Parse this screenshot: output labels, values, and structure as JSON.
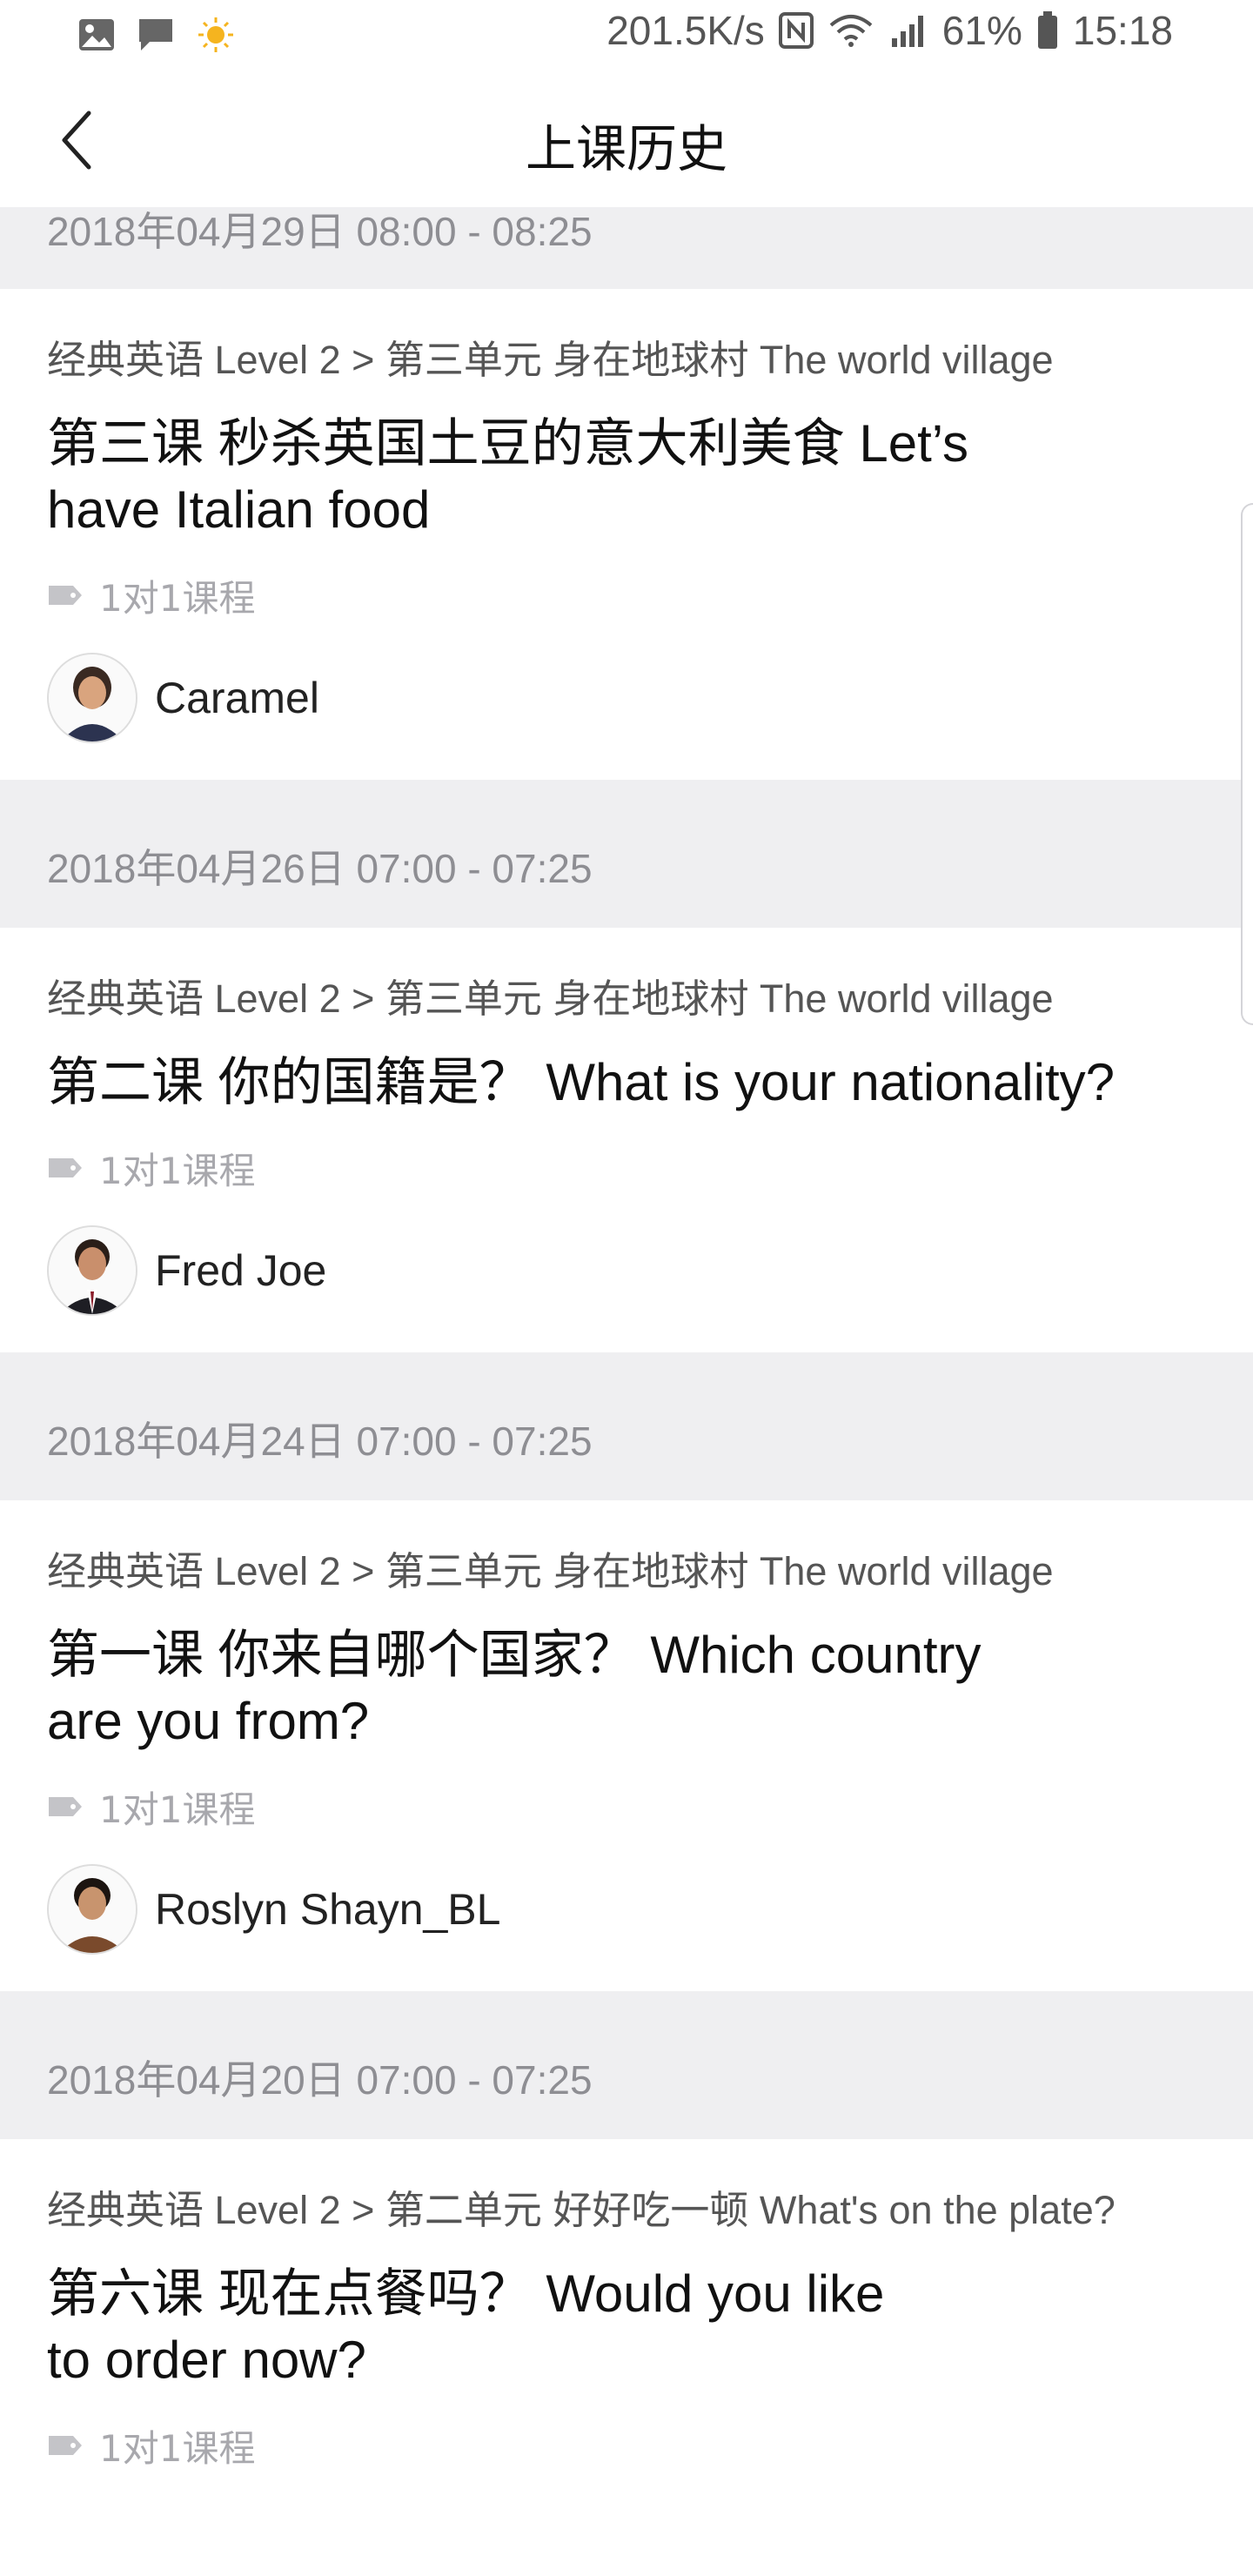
{
  "status_bar": {
    "network_speed": "201.5K/s",
    "battery_percent": "61%",
    "time": "15:18",
    "icons": [
      "gallery-icon",
      "message-icon",
      "weather-sun-icon",
      "nfc-icon",
      "wifi-icon",
      "signal-icon",
      "battery-icon"
    ]
  },
  "nav": {
    "title": "上课历史",
    "back_icon": "chevron-left-icon"
  },
  "sessions": [
    {
      "date": "2018年04月29日 08:00 - 08:25",
      "breadcrumb": "经典英语 Level 2 > 第三单元 身在地球村 The world village",
      "title_line1": "第三课 秒杀英国土豆的意大利美食 Let’s",
      "title_line2": "have Italian food",
      "tag": "1对1课程",
      "teacher": "Caramel"
    },
    {
      "date": "2018年04月26日 07:00 - 07:25",
      "breadcrumb": "经典英语 Level 2 > 第三单元 身在地球村 The world village",
      "title_line1": "第二课 你的国籍是？ What is your nationality?",
      "title_line2": "",
      "tag": "1对1课程",
      "teacher": "Fred Joe"
    },
    {
      "date": "2018年04月24日 07:00 - 07:25",
      "breadcrumb": "经典英语 Level 2 > 第三单元 身在地球村 The world village",
      "title_line1": "第一课 你来自哪个国家？ Which country",
      "title_line2": "are you from?",
      "tag": "1对1课程",
      "teacher": "Roslyn Shayn_BL"
    },
    {
      "date": "2018年04月20日 07:00 - 07:25",
      "breadcrumb": "经典英语 Level 2 > 第二单元 好好吃一顿 What's on the plate?",
      "title_line1": "第六课 现在点餐吗？ Would you like",
      "title_line2": "to order now?",
      "tag": "1对1课程",
      "teacher": ""
    }
  ],
  "colors": {
    "background": "#ffffff",
    "section_header": "#efeff1",
    "muted_text": "#8e8e93",
    "tag_text": "#a8a8ad"
  }
}
